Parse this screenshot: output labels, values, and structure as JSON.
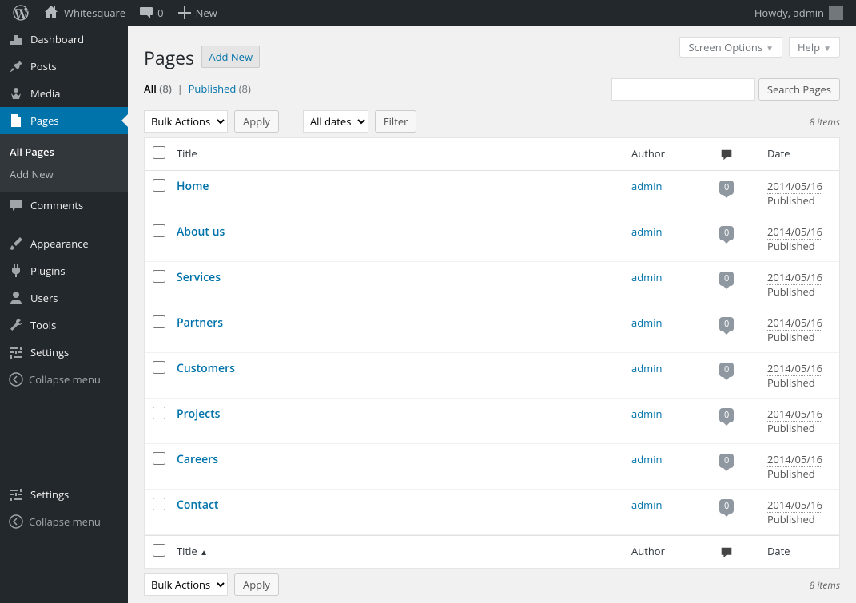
{
  "topbar": {
    "site_name": "Whitesquare",
    "comment_count": "0",
    "new_label": "New",
    "howdy": "Howdy, admin"
  },
  "sidebar": {
    "dashboard": "Dashboard",
    "posts": "Posts",
    "media": "Media",
    "pages": "Pages",
    "pages_sub_all": "All Pages",
    "pages_sub_add": "Add New",
    "comments": "Comments",
    "appearance": "Appearance",
    "plugins": "Plugins",
    "users": "Users",
    "tools": "Tools",
    "settings": "Settings",
    "collapse": "Collapse menu",
    "settings2": "Settings",
    "collapse2": "Collapse menu"
  },
  "header": {
    "screen_options": "Screen Options",
    "help": "Help",
    "title": "Pages",
    "add_new": "Add New"
  },
  "filters": {
    "all_label": "All",
    "all_count": "(8)",
    "published_label": "Published",
    "published_count": "(8)",
    "search_btn": "Search Pages",
    "bulk_actions": "Bulk Actions",
    "apply": "Apply",
    "all_dates": "All dates",
    "filter": "Filter",
    "items_count": "8 items"
  },
  "table": {
    "th_title": "Title",
    "th_author": "Author",
    "th_date": "Date",
    "rows": [
      {
        "title": "Home",
        "author": "admin",
        "comments": "0",
        "date": "2014/05/16",
        "status": "Published"
      },
      {
        "title": "About us",
        "author": "admin",
        "comments": "0",
        "date": "2014/05/16",
        "status": "Published"
      },
      {
        "title": "Services",
        "author": "admin",
        "comments": "0",
        "date": "2014/05/16",
        "status": "Published"
      },
      {
        "title": "Partners",
        "author": "admin",
        "comments": "0",
        "date": "2014/05/16",
        "status": "Published"
      },
      {
        "title": "Customers",
        "author": "admin",
        "comments": "0",
        "date": "2014/05/16",
        "status": "Published"
      },
      {
        "title": "Projects",
        "author": "admin",
        "comments": "0",
        "date": "2014/05/16",
        "status": "Published"
      },
      {
        "title": "Careers",
        "author": "admin",
        "comments": "0",
        "date": "2014/05/16",
        "status": "Published"
      },
      {
        "title": "Contact",
        "author": "admin",
        "comments": "0",
        "date": "2014/05/16",
        "status": "Published"
      }
    ]
  }
}
